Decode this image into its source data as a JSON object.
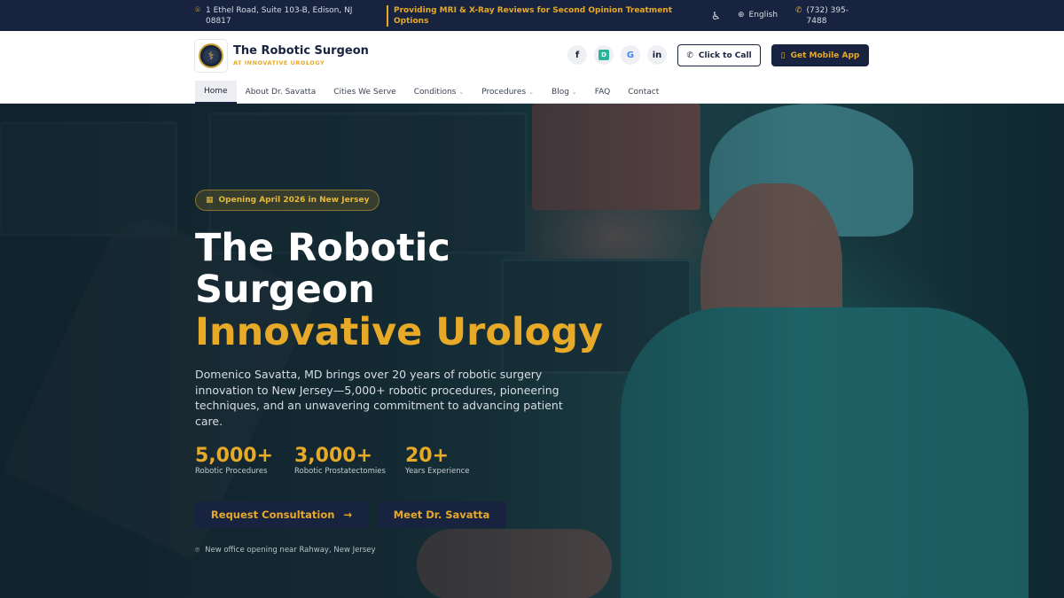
{
  "topbar": {
    "address": "1 Ethel Road, Suite 103-B, Edison, NJ 08817",
    "promo": "Providing MRI & X-Ray Reviews for Second Opinion Treatment Options",
    "language": "English",
    "phone": "(732) 395-7488"
  },
  "header": {
    "brand_title": "The Robotic Surgeon",
    "brand_subtitle": "AT INNOVATIVE UROLOGY",
    "social": [
      "facebook",
      "doximity",
      "google",
      "linkedin"
    ],
    "call_button": "Click to Call",
    "app_button": "Get Mobile App"
  },
  "nav": {
    "items": [
      {
        "label": "Home",
        "active": true,
        "dropdown": false
      },
      {
        "label": "About Dr. Savatta",
        "active": false,
        "dropdown": false
      },
      {
        "label": "Cities We Serve",
        "active": false,
        "dropdown": false
      },
      {
        "label": "Conditions",
        "active": false,
        "dropdown": true
      },
      {
        "label": "Procedures",
        "active": false,
        "dropdown": true
      },
      {
        "label": "Blog",
        "active": false,
        "dropdown": true
      },
      {
        "label": "FAQ",
        "active": false,
        "dropdown": false
      },
      {
        "label": "Contact",
        "active": false,
        "dropdown": false
      }
    ]
  },
  "hero": {
    "badge": "Opening April 2026 in New Jersey",
    "title_line1": "The Robotic",
    "title_line2": "Surgeon",
    "title_line3": "Innovative Urology",
    "description": "Domenico Savatta, MD brings over 20 years of robotic surgery innovation to New Jersey—5,000+ robotic procedures, pioneering techniques, and an unwavering commitment to advancing patient care.",
    "stats": [
      {
        "value": "5,000+",
        "label": "Robotic Procedures"
      },
      {
        "value": "3,000+",
        "label": "Robotic Prostatectomies"
      },
      {
        "value": "20+",
        "label": "Years Experience"
      }
    ],
    "primary_button": "Request Consultation",
    "secondary_button": "Meet Dr. Savatta",
    "note": "New office opening near Rahway, New Jersey"
  },
  "colors": {
    "navy": "#18233f",
    "gold": "#e6a928"
  }
}
